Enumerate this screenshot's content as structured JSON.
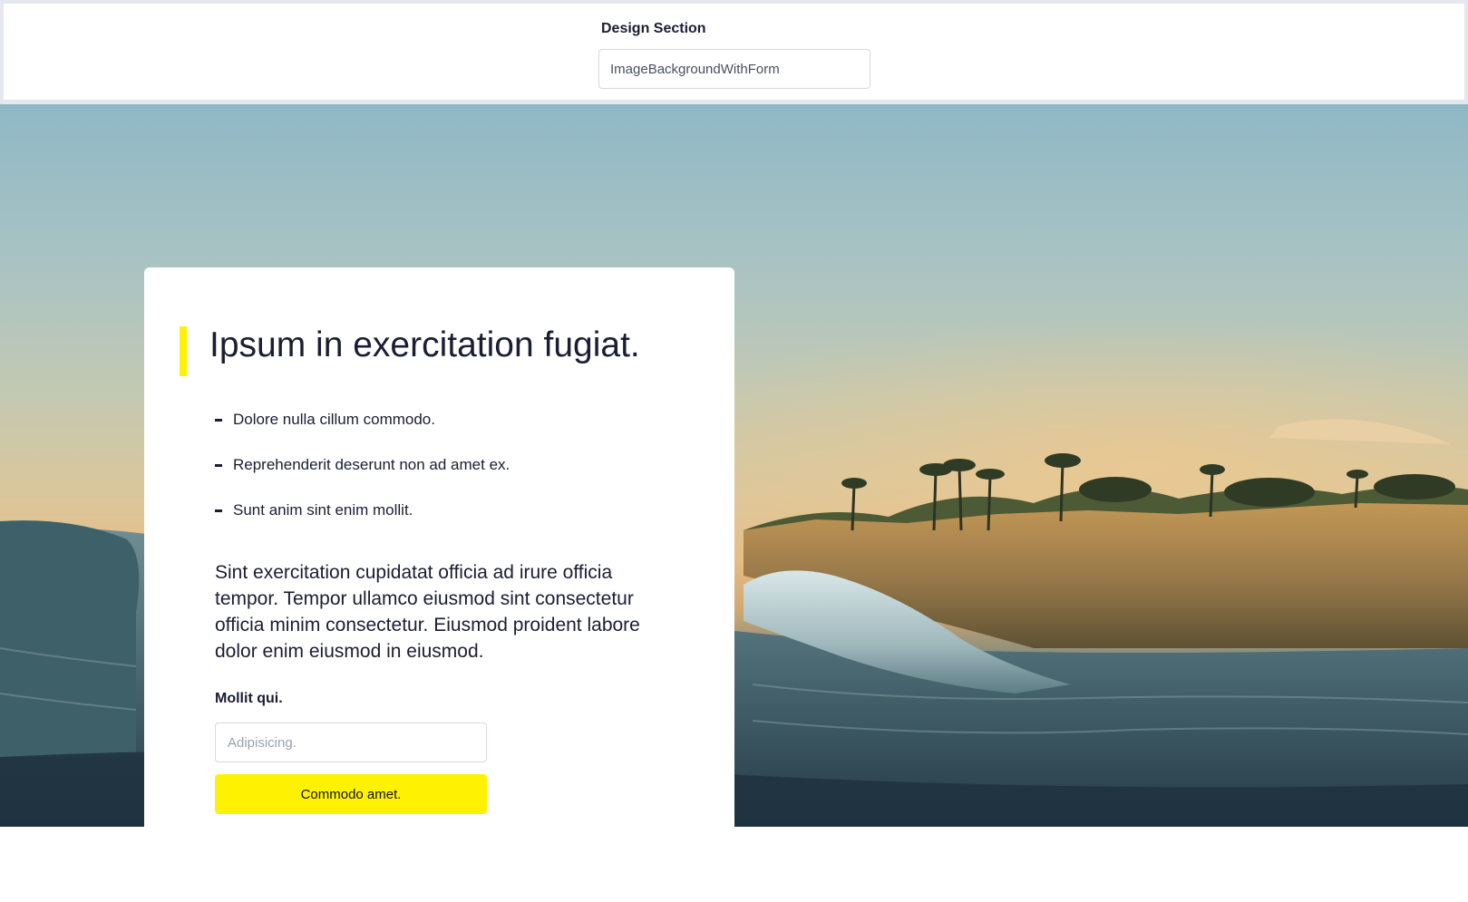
{
  "design_selector": {
    "label": "Design Section",
    "value": "ImageBackgroundWithForm"
  },
  "hero": {
    "background": "coastal-sunset-wave-photo",
    "card": {
      "title": "Ipsum in exercitation fugiat.",
      "bullets": [
        "Dolore nulla cillum commodo.",
        "Reprehenderit deserunt non ad amet ex.",
        "Sunt anim sint enim mollit."
      ],
      "description": "Sint exercitation cupidatat officia ad irure officia tempor. Tempor ullamco eiusmod sint consectetur officia minim consectetur. Eiusmod proident labore dolor enim eiusmod in eiusmod.",
      "form": {
        "label": "Mollit qui.",
        "placeholder": "Adipisicing.",
        "button_label": "Commodo amet."
      }
    }
  },
  "colors": {
    "accent": "#fff200",
    "text": "#1b1d33"
  }
}
